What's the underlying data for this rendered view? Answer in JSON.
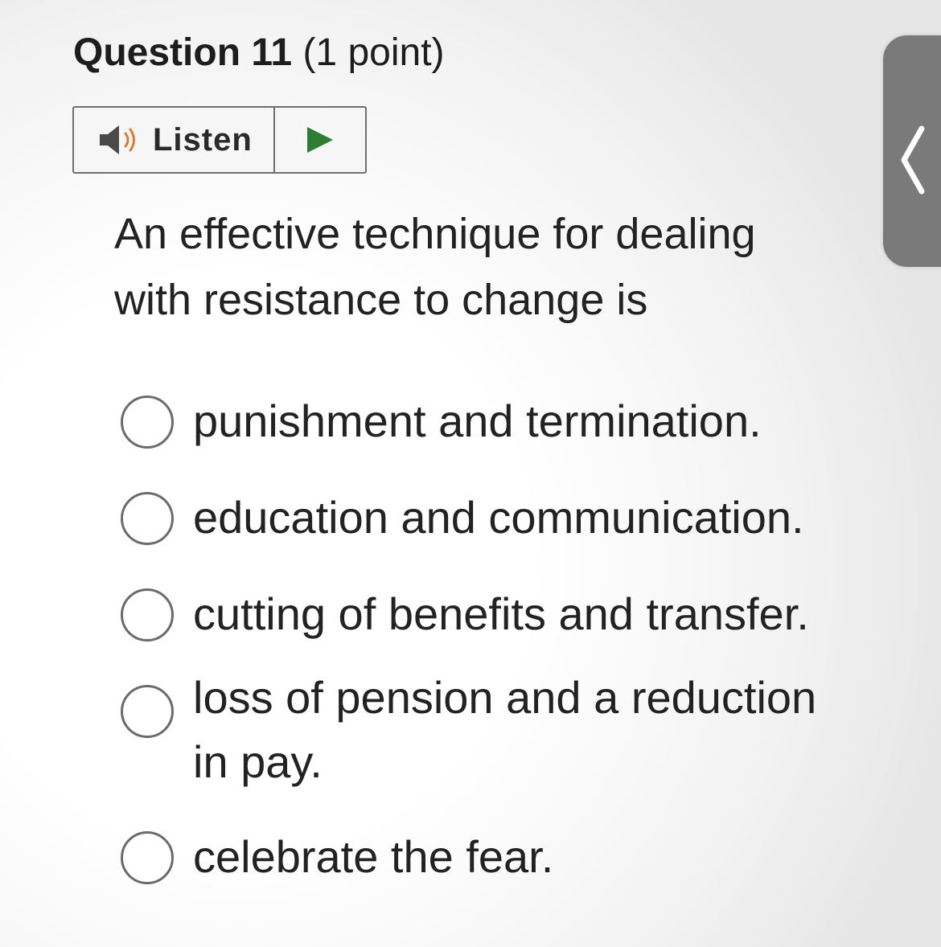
{
  "question": {
    "title": "Question 11",
    "points": "(1 point)",
    "text": "An effective technique for dealing with resistance to change is"
  },
  "listen": {
    "label": "Listen",
    "icon": "speaker-icon",
    "play_icon": "play-icon",
    "accent_color": "#2e7d32"
  },
  "options": [
    {
      "label": "punishment and termination.",
      "selected": false
    },
    {
      "label": "education and communication.",
      "selected": false
    },
    {
      "label": "cutting of benefits and transfer.",
      "selected": false
    },
    {
      "label": "loss of pension and a reduction in pay.",
      "selected": false
    },
    {
      "label": "celebrate the fear.",
      "selected": false
    }
  ],
  "side_tab": {
    "icon": "chevron-left-icon"
  }
}
